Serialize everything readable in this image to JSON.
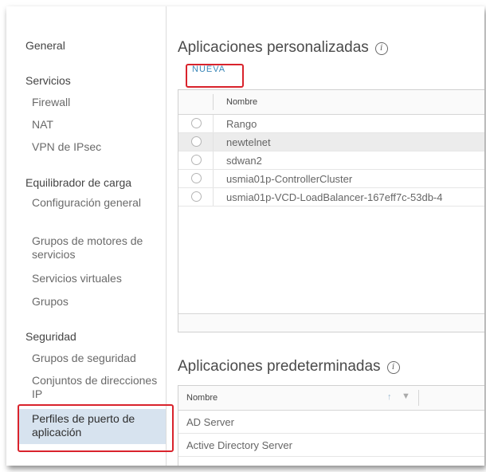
{
  "sidebar": {
    "general": "General",
    "servicios": {
      "header": "Servicios",
      "items": [
        "Firewall",
        "NAT",
        "VPN de IPsec"
      ]
    },
    "equilibrador": {
      "header": "Equilibrador de carga",
      "items": [
        "Configuración general",
        "Grupos de motores de servicios",
        "Servicios virtuales",
        "Grupos"
      ]
    },
    "seguridad": {
      "header": "Seguridad",
      "items": [
        "Grupos de seguridad",
        "Conjuntos de direcciones IP",
        "Perfiles de puerto de aplicación"
      ]
    }
  },
  "custom_apps": {
    "title": "Aplicaciones personalizadas",
    "info_icon": "i",
    "new_button": "NUEVA",
    "column": "Nombre",
    "rows": [
      "Rango",
      "newtelnet",
      "sdwan2",
      "usmia01p-ControllerCluster",
      "usmia01p-VCD-LoadBalancer-167eff7c-53db-4"
    ]
  },
  "default_apps": {
    "title": "Aplicaciones predeterminadas",
    "info_icon": "i",
    "column": "Nombre",
    "sort_icon": "↑",
    "filter_icon": "▼",
    "rows": [
      "AD Server",
      "Active Directory Server"
    ]
  },
  "colors": {
    "highlight": "#d9232c",
    "selected_bg": "#d7e3ef",
    "link": "#3b87b8"
  }
}
